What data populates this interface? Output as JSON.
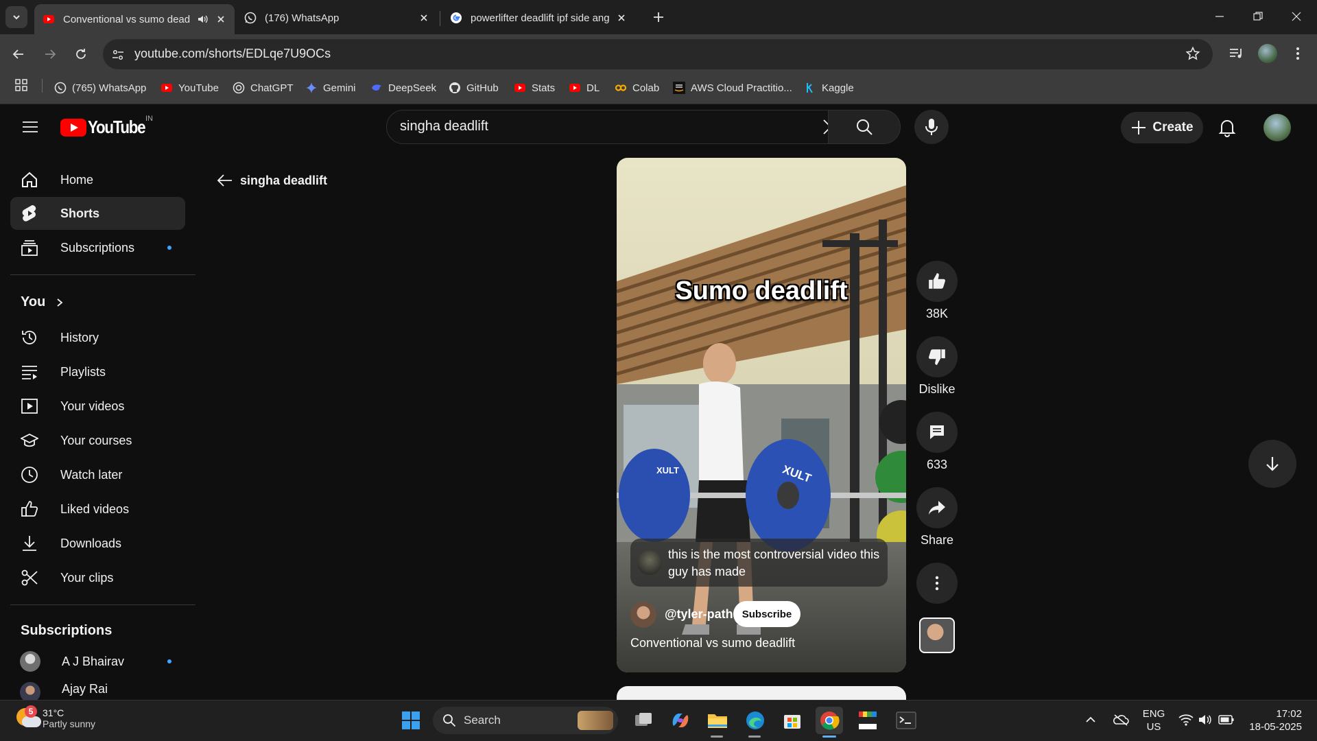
{
  "browser": {
    "tabs": [
      {
        "title": "Conventional vs sumo dead",
        "active": true,
        "favicon": "youtube-icon",
        "audio": true
      },
      {
        "title": "(176) WhatsApp",
        "active": false,
        "favicon": "whatsapp-icon"
      },
      {
        "title": "powerlifter deadlift ipf side ang",
        "active": false,
        "favicon": "google-icon"
      }
    ],
    "url": "youtube.com/shorts/EDLqe7U9OCs",
    "bookmarks": [
      {
        "label": "(765) WhatsApp",
        "icon": "whatsapp-icon"
      },
      {
        "label": "YouTube",
        "icon": "youtube-icon"
      },
      {
        "label": "ChatGPT",
        "icon": "chatgpt-icon"
      },
      {
        "label": "Gemini",
        "icon": "gemini-icon"
      },
      {
        "label": "DeepSeek",
        "icon": "deepseek-icon"
      },
      {
        "label": "GitHub",
        "icon": "github-icon"
      },
      {
        "label": "Stats",
        "icon": "youtube-icon"
      },
      {
        "label": "DL",
        "icon": "youtube-icon"
      },
      {
        "label": "Colab",
        "icon": "colab-icon"
      },
      {
        "label": "AWS Cloud Practitio...",
        "icon": "aws-icon"
      },
      {
        "label": "Kaggle",
        "icon": "kaggle-icon"
      }
    ]
  },
  "youtube": {
    "logo_text": "YouTube",
    "country_code": "IN",
    "search_query": "singha deadlift",
    "create_label": "Create",
    "back_label": "singha deadlift",
    "sidebar": {
      "main": [
        {
          "label": "Home",
          "icon": "home-icon"
        },
        {
          "label": "Shorts",
          "icon": "shorts-icon",
          "active": true
        },
        {
          "label": "Subscriptions",
          "icon": "subscriptions-icon",
          "new": true
        }
      ],
      "you_heading": "You",
      "you": [
        {
          "label": "History",
          "icon": "history-icon"
        },
        {
          "label": "Playlists",
          "icon": "playlists-icon"
        },
        {
          "label": "Your videos",
          "icon": "your-videos-icon"
        },
        {
          "label": "Your courses",
          "icon": "courses-icon"
        },
        {
          "label": "Watch later",
          "icon": "clock-icon"
        },
        {
          "label": "Liked videos",
          "icon": "thumbs-up-icon"
        },
        {
          "label": "Downloads",
          "icon": "download-icon"
        },
        {
          "label": "Your clips",
          "icon": "scissors-icon"
        }
      ],
      "subscriptions_heading": "Subscriptions",
      "subscriptions": [
        {
          "label": "A J Bhairav",
          "new": true
        },
        {
          "label": "Ajay Rai",
          "new": false
        }
      ]
    },
    "short": {
      "overlay_title": "Sumo deadlift",
      "caption": "this is the most controversial video this guy has made",
      "channel": "@tyler-path",
      "subscribe_label": "Subscribe",
      "title": "Conventional vs sumo deadlift",
      "likes": "38K",
      "dislike_label": "Dislike",
      "comments": "633",
      "share_label": "Share"
    }
  },
  "taskbar": {
    "weather_temp": "31°C",
    "weather_desc": "Partly sunny",
    "weather_badge": "5",
    "search_label": "Search",
    "lang_line1": "ENG",
    "lang_line2": "US",
    "time": "17:02",
    "date": "18-05-2025"
  },
  "colors": {
    "youtube_red": "#ff0000",
    "background": "#0f0f0f",
    "link_blue": "#3ea6ff"
  }
}
